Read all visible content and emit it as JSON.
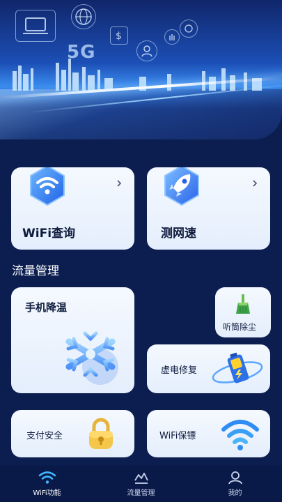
{
  "features": {
    "wifi_query": {
      "label": "WiFi查询"
    },
    "speed_test": {
      "label": "测网速"
    }
  },
  "section_title": "流量管理",
  "tools": {
    "phone_cool": {
      "label": "手机降温"
    },
    "speaker_clean": {
      "label": "听筒除尘"
    },
    "battery_repair": {
      "label": "虚电修复"
    },
    "payment_security": {
      "label": "支付安全"
    },
    "wifi_guard": {
      "label": "WiFi保镖"
    }
  },
  "banner": {
    "text_5g": "5G"
  },
  "nav": {
    "items": [
      {
        "label": "WiFi功能",
        "icon": "wifi-icon",
        "active": true
      },
      {
        "label": "流量管理",
        "icon": "traffic-chart-icon",
        "active": false
      },
      {
        "label": "我的",
        "icon": "user-icon",
        "active": false
      }
    ]
  },
  "colors": {
    "background": "#0b1e4f",
    "card": "#eef4fe",
    "accent_blue": "#2f7cf0",
    "nav_active": "#3fb6ff"
  }
}
